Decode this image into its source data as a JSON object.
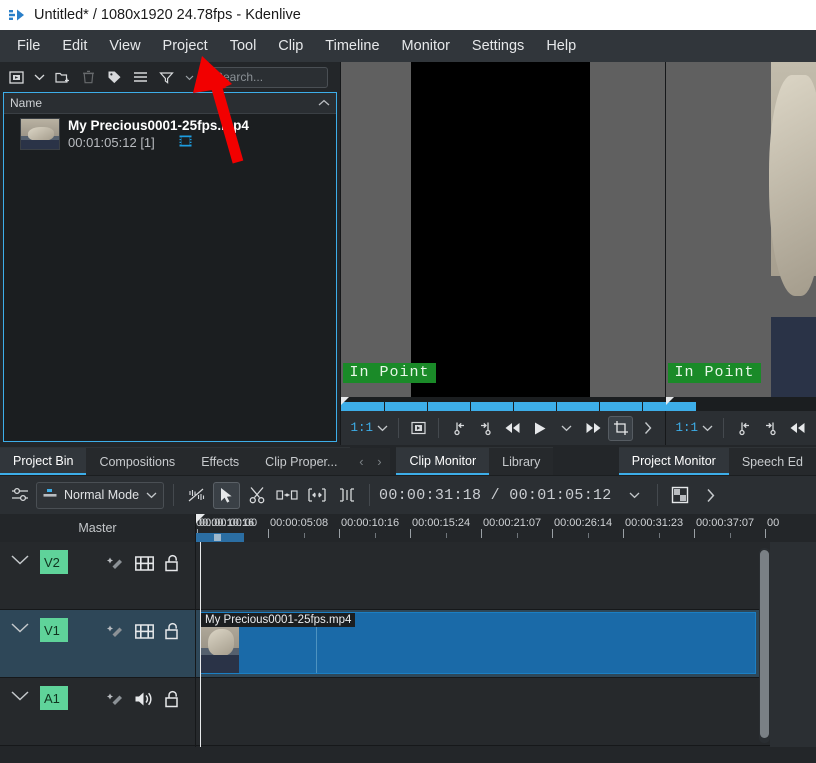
{
  "window": {
    "title": "Untitled* / 1080x1920 24.78fps - Kdenlive",
    "app_icon": "kdenlive-icon"
  },
  "menubar": {
    "items": [
      {
        "label": "File"
      },
      {
        "label": "Edit"
      },
      {
        "label": "View"
      },
      {
        "label": "Project"
      },
      {
        "label": "Tool"
      },
      {
        "label": "Clip"
      },
      {
        "label": "Timeline"
      },
      {
        "label": "Monitor"
      },
      {
        "label": "Settings"
      },
      {
        "label": "Help"
      }
    ]
  },
  "project_bin": {
    "toolbar": [
      {
        "name": "add-clip-icon",
        "tooltip": "Add Clip"
      },
      {
        "name": "chevron-down-icon",
        "tooltip": "Add Clip Menu"
      },
      {
        "name": "add-folder-icon",
        "tooltip": "Create Folder"
      },
      {
        "name": "delete-icon",
        "tooltip": "Delete Clip",
        "disabled": true
      },
      {
        "name": "tag-icon",
        "tooltip": "Tags"
      },
      {
        "name": "menu-icon",
        "tooltip": "Options"
      },
      {
        "name": "filter-icon",
        "tooltip": "Filter"
      }
    ],
    "search": {
      "value": "",
      "placeholder": "Search..."
    },
    "columns": [
      "Name"
    ],
    "sort_indicator": "chevron-up-icon",
    "clips": [
      {
        "name": "My Precious0001-25fps.mp4",
        "duration": "00:01:05:12",
        "usage": "[1]",
        "type_icon": "video-clip-icon"
      }
    ]
  },
  "clip_monitor": {
    "overlay_label": "In Point",
    "zoom": "1:1",
    "toolbar": [
      {
        "name": "zoom-level-select"
      },
      {
        "name": "monitor-fullscreen-icon"
      },
      {
        "name": "set-in-point-icon"
      },
      {
        "name": "set-out-point-icon"
      },
      {
        "name": "rewind-icon"
      },
      {
        "name": "play-icon"
      },
      {
        "name": "play-menu-chevron-icon"
      },
      {
        "name": "forward-icon"
      },
      {
        "name": "crop-zone-icon"
      },
      {
        "name": "more-options-icon"
      }
    ]
  },
  "project_monitor": {
    "overlay_label": "In Point",
    "zoom": "1:1"
  },
  "left_dock_tabs": {
    "items": [
      {
        "label": "Project Bin",
        "selected": true
      },
      {
        "label": "Compositions",
        "selected": false
      },
      {
        "label": "Effects",
        "selected": false
      },
      {
        "label": "Clip Proper...",
        "selected": false
      }
    ],
    "nav": [
      "‹",
      "›"
    ]
  },
  "center_dock_tabs": {
    "items": [
      {
        "label": "Clip Monitor",
        "selected": true
      },
      {
        "label": "Library",
        "selected": false
      }
    ]
  },
  "right_dock_tabs": {
    "items": [
      {
        "label": "Project Monitor",
        "selected": true
      },
      {
        "label": "Speech Ed",
        "selected": false
      }
    ]
  },
  "timeline_toolbar": {
    "settings_icon": "timeline-settings-icon",
    "edit_mode": {
      "label": "Normal Mode",
      "icon": "normal-mode-icon",
      "chevron": "chevron-down-icon"
    },
    "tools": [
      {
        "name": "mix-clips-icon",
        "active": false
      },
      {
        "name": "select-tool-icon",
        "active": true
      },
      {
        "name": "razor-tool-icon",
        "active": false
      },
      {
        "name": "spacer-tool-icon",
        "active": false
      },
      {
        "name": "ripple-tool-icon",
        "active": false
      },
      {
        "name": "roll-tool-icon",
        "active": false
      }
    ],
    "position": "00:00:31:18",
    "separator": "/",
    "duration": "00:01:05:12",
    "timecode_chevron": "chevron-down-icon",
    "preview_icon": "timeline-preview-icon",
    "more_icon": "chevron-right-icon"
  },
  "timeline": {
    "master_label": "Master",
    "ruler_labels": [
      "00:00:00:00",
      "00:00:05:08",
      "00:00:10:16",
      "00:00:15:24",
      "00:00:21:07",
      "00:00:26:14",
      "00:00:31:23",
      "00:00:37:07",
      "00"
    ],
    "tracks": [
      {
        "tag": "V2",
        "kind": "video",
        "selected": false,
        "icons": [
          "effects-icon",
          "video-hide-icon",
          "lock-icon"
        ]
      },
      {
        "tag": "V1",
        "kind": "video",
        "selected": true,
        "icons": [
          "effects-icon",
          "video-hide-icon",
          "lock-icon"
        ]
      },
      {
        "tag": "A1",
        "kind": "audio",
        "selected": false,
        "icons": [
          "effects-icon",
          "audio-mute-icon",
          "lock-icon"
        ]
      }
    ],
    "clips": [
      {
        "track": "V1",
        "label": "My Precious0001-25fps.mp4"
      }
    ]
  },
  "annotation": {
    "arrow": {
      "color": "#f20000",
      "points_to": "Project"
    }
  },
  "colors": {
    "accent": "#3daee9",
    "clip": "#1a6aa8",
    "track_tag": "#5fd39a",
    "inpoint": "#1a8a28",
    "window_bg": "#232629",
    "toolbar_bg": "#2b2f33",
    "annotation": "#f20000"
  }
}
